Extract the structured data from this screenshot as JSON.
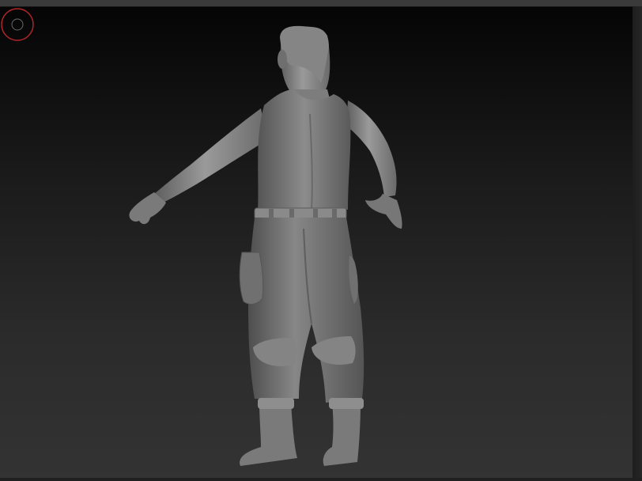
{
  "app": {
    "name": "sculpt-viewport"
  },
  "viewport": {
    "background_top": "#050505",
    "background_bottom": "#333333",
    "model": {
      "icon": "humanoid-figure-back-view",
      "material_color": "#8a8a8a"
    },
    "brush_cursor": {
      "icon": "brush-circle-icon",
      "color": "#b0262a"
    }
  }
}
